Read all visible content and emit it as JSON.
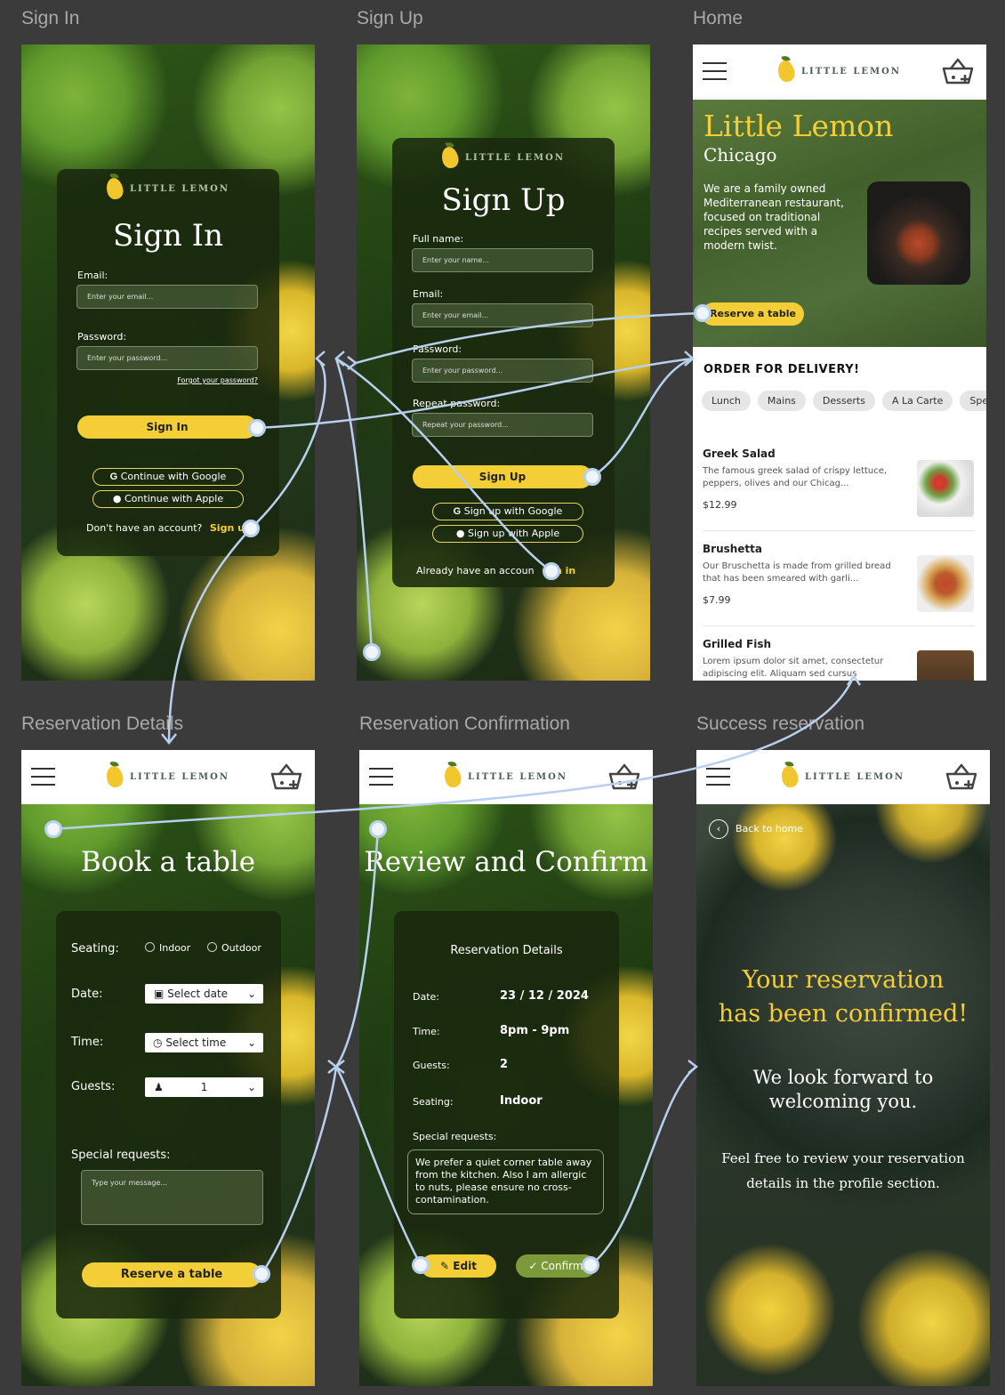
{
  "frame_titles": {
    "signin": "Sign In",
    "signup": "Sign Up",
    "home": "Home",
    "reservation_details": "Reservation Details",
    "reservation_confirmation": "Reservation Confirmation",
    "success": "Success reservation"
  },
  "logo_text": "LITTLE LEMON",
  "signin": {
    "title": "Sign In",
    "email_label": "Email:",
    "email_placeholder": "Enter your email...",
    "password_label": "Password:",
    "password_placeholder": "Enter your password...",
    "forgot": "Forgot your password?",
    "button": "Sign In",
    "google": "Continue with Google",
    "apple": "Continue with Apple",
    "no_account": "Don't have an account?",
    "signup_link": "Sign u"
  },
  "signup": {
    "title": "Sign Up",
    "name_label": "Full name:",
    "name_placeholder": "Enter your name...",
    "email_label": "Email:",
    "email_placeholder": "Enter your email...",
    "password_label": "Password:",
    "password_placeholder": "Enter your password...",
    "repeat_label": "Repeat password:",
    "repeat_placeholder": "Repeat your password...",
    "button": "Sign Up",
    "google": "Sign up with Google",
    "apple": "Sign up with Apple",
    "have_account": "Already have an accoun",
    "signin_link": "gn in"
  },
  "home": {
    "title": "Little Lemon",
    "subtitle": "Chicago",
    "description": "We are a family owned Mediterranean restaurant, focused on traditional recipes served with a modern twist.",
    "reserve_button": "Reserve a table",
    "order_heading": "ORDER FOR DELIVERY!",
    "categories": [
      "Lunch",
      "Mains",
      "Desserts",
      "A La Carte",
      "Spe"
    ],
    "dishes": [
      {
        "title": "Greek Salad",
        "desc": "The famous greek salad of crispy lettuce, peppers, olives and our Chicag...",
        "price": "$12.99"
      },
      {
        "title": "Brushetta",
        "desc": "Our Bruschetta is made from grilled bread that has been smeared with garli...",
        "price": "$7.99"
      },
      {
        "title": "Grilled Fish",
        "desc": "Lorem ipsum dolor sit amet, consectetur adipiscing elit. Aliquam sed cursus",
        "price": ""
      }
    ]
  },
  "book": {
    "title": "Book a table",
    "seating_label": "Seating:",
    "indoor": "Indoor",
    "outdoor": "Outdoor",
    "date_label": "Date:",
    "date_value": "Select date",
    "time_label": "Time:",
    "time_value": "Select time",
    "guests_label": "Guests:",
    "guests_value": "1",
    "special_label": "Special requests:",
    "message_placeholder": "Type your message...",
    "button": "Reserve a table"
  },
  "review": {
    "title": "Review and Confirm",
    "panel_title": "Reservation Details",
    "date_label": "Date:",
    "date_value": "23 / 12 / 2024",
    "time_label": "Time:",
    "time_value": "8pm - 9pm",
    "guests_label": "Guests:",
    "guests_value": "2",
    "seating_label": "Seating:",
    "seating_value": "Indoor",
    "special_label": "Special requests:",
    "special_value": "We prefer a quiet corner table away from the kitchen. Also I am allergic to nuts, please ensure no cross-contamination.",
    "edit": "Edit",
    "confirm": "Confirm"
  },
  "success": {
    "back": "Back to home",
    "headline1": "Your reservation",
    "headline2": "has been confirmed!",
    "line1": "We look forward to",
    "line2": "welcoming you.",
    "line3": "Feel free to review your reservation",
    "line4": "details in the profile section."
  },
  "colors": {
    "brand_yellow": "#f4ce36",
    "brand_green": "#495e57",
    "connector": "#b8d0ee"
  }
}
